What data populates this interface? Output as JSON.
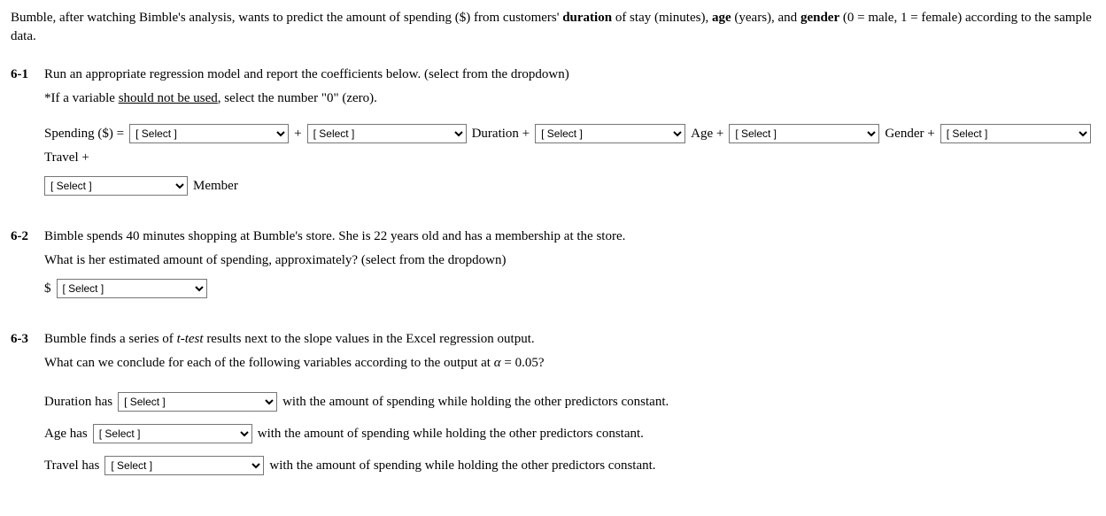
{
  "intro": {
    "pre": "Bumble, after watching Bimble's analysis, wants to predict the amount of spending ($) from customers' ",
    "b1": "duration",
    "mid1": " of stay (minutes), ",
    "b2": "age",
    "mid2": " (years), and ",
    "b3": "gender",
    "post": " (0 = male, 1 = female) according to the sample data."
  },
  "q6_1": {
    "num": "6-1",
    "line1": "Run an appropriate regression model and report the coefficients below. (select from the dropdown)",
    "line2_pre": "*If a variable ",
    "line2_under": "should not be used",
    "line2_post": ", select the number \"0\" (zero).",
    "eq": {
      "lhs": "Spending ($) = ",
      "plus": " + ",
      "v1": " Duration + ",
      "v2": " Age + ",
      "v3": " Gender + ",
      "v4": " Travel + ",
      "v5": " Member"
    }
  },
  "q6_2": {
    "num": "6-2",
    "line1": "Bimble spends 40 minutes shopping at Bumble's store. She is 22 years old and has a membership at the store.",
    "line2": "What is her estimated amount of spending, approximately? (select from the dropdown)",
    "dollar": "$"
  },
  "q6_3": {
    "num": "6-3",
    "line1_pre": "Bumble finds a series of ",
    "line1_it": "t-test",
    "line1_post": " results next to the slope values in the Excel regression output.",
    "line2_pre": "What can we conclude for each of the following variables according to the output at ",
    "alpha": "α",
    "line2_post": " = 0.05?",
    "items": {
      "duration_pre": "Duration has ",
      "age_pre": "Age has ",
      "travel_pre": "Travel has ",
      "tail": " with the amount of spending while holding the other predictors constant."
    }
  },
  "select_placeholder": "[ Select ]"
}
